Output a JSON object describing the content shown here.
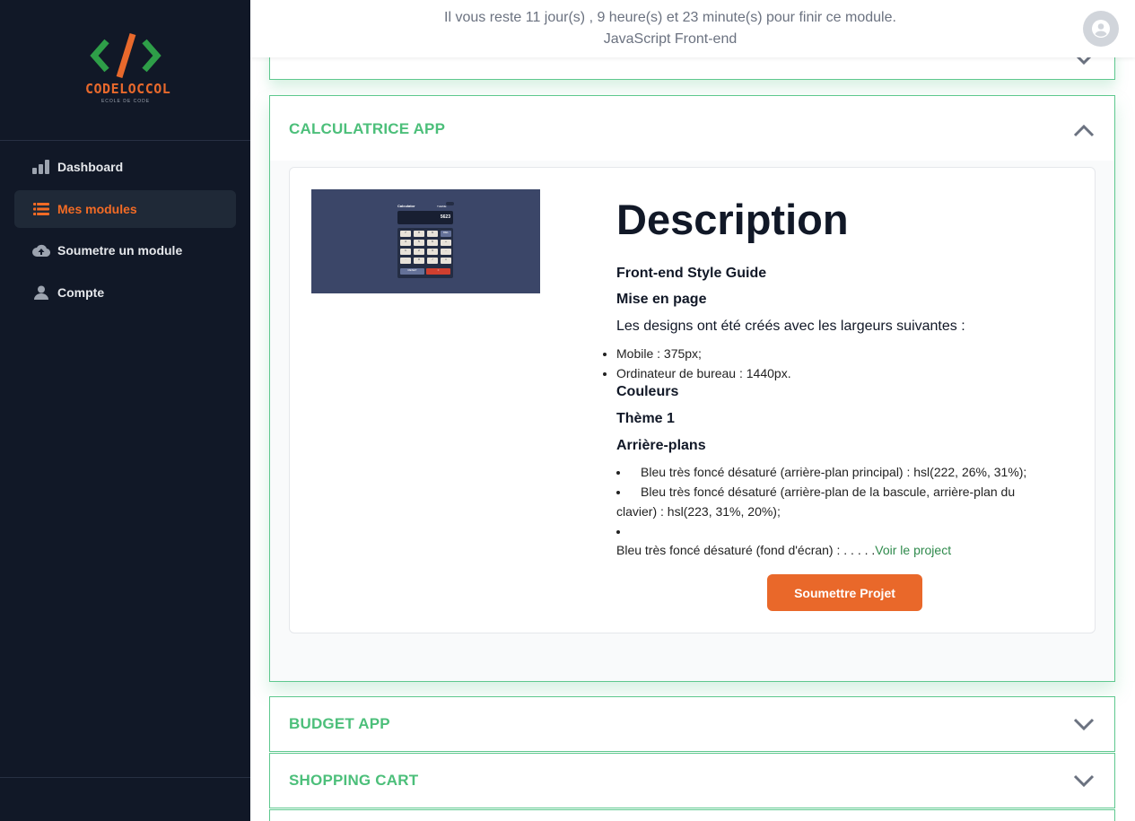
{
  "brand": {
    "name": "CODELOCCOL",
    "tagline": "ECOLE DE CODE"
  },
  "sidebar": {
    "items": [
      {
        "label": "Dashboard",
        "icon": "bar-chart-icon",
        "active": false
      },
      {
        "label": "Mes modules",
        "icon": "list-icon",
        "active": true
      },
      {
        "label": "Soumetre un module",
        "icon": "cloud-upload-icon",
        "active": false
      },
      {
        "label": "Compte",
        "icon": "user-icon",
        "active": false
      }
    ]
  },
  "topbar": {
    "countdown": "Il vous reste 11 jour(s) , 9 heure(s) et 23 minute(s) pour finir ce module.",
    "module": "JavaScript Front-end"
  },
  "projects": [
    {
      "title": "CALCULATRICE APP",
      "expanded": true
    },
    {
      "title": "BUDGET APP",
      "expanded": false
    },
    {
      "title": "SHOPPING CART",
      "expanded": false
    }
  ],
  "detail": {
    "heading": "Description",
    "style_guide": "Front-end Style Guide",
    "layout_title": "Mise en page",
    "layout_text": "Les designs ont été créés avec les largeurs suivantes :",
    "widths": [
      "Mobile : 375px;",
      "Ordinateur de bureau : 1440px."
    ],
    "colors_title": "Couleurs",
    "theme_title": "Thème 1",
    "bg_title": "Arrière-plans",
    "bg_items": [
      "Bleu très foncé désaturé (arrière-plan principal) : hsl(222, 26%, 31%);",
      "Bleu très foncé désaturé (arrière-plan de la bascule, arrière-plan du clavier) : hsl(223, 31%, 20%);"
    ],
    "truncated": "Bleu très foncé désaturé (fond d'écran) : . . . . .",
    "link": "Voir le project",
    "submit": "Soumettre Projet"
  },
  "preview": {
    "title": "Calculator",
    "theme_label": "THEME",
    "display": "5623",
    "keys": [
      "7",
      "8",
      "9",
      "DEL",
      "4",
      "5",
      "6",
      "+",
      "1",
      "2",
      "3",
      "-",
      ".",
      "0",
      "/",
      "x"
    ],
    "reset": "RESET",
    "equals": "="
  },
  "colors": {
    "sidebar": "#111827",
    "accent": "#e9682a",
    "green": "#4cbf7a",
    "border": "#5ec88e"
  }
}
